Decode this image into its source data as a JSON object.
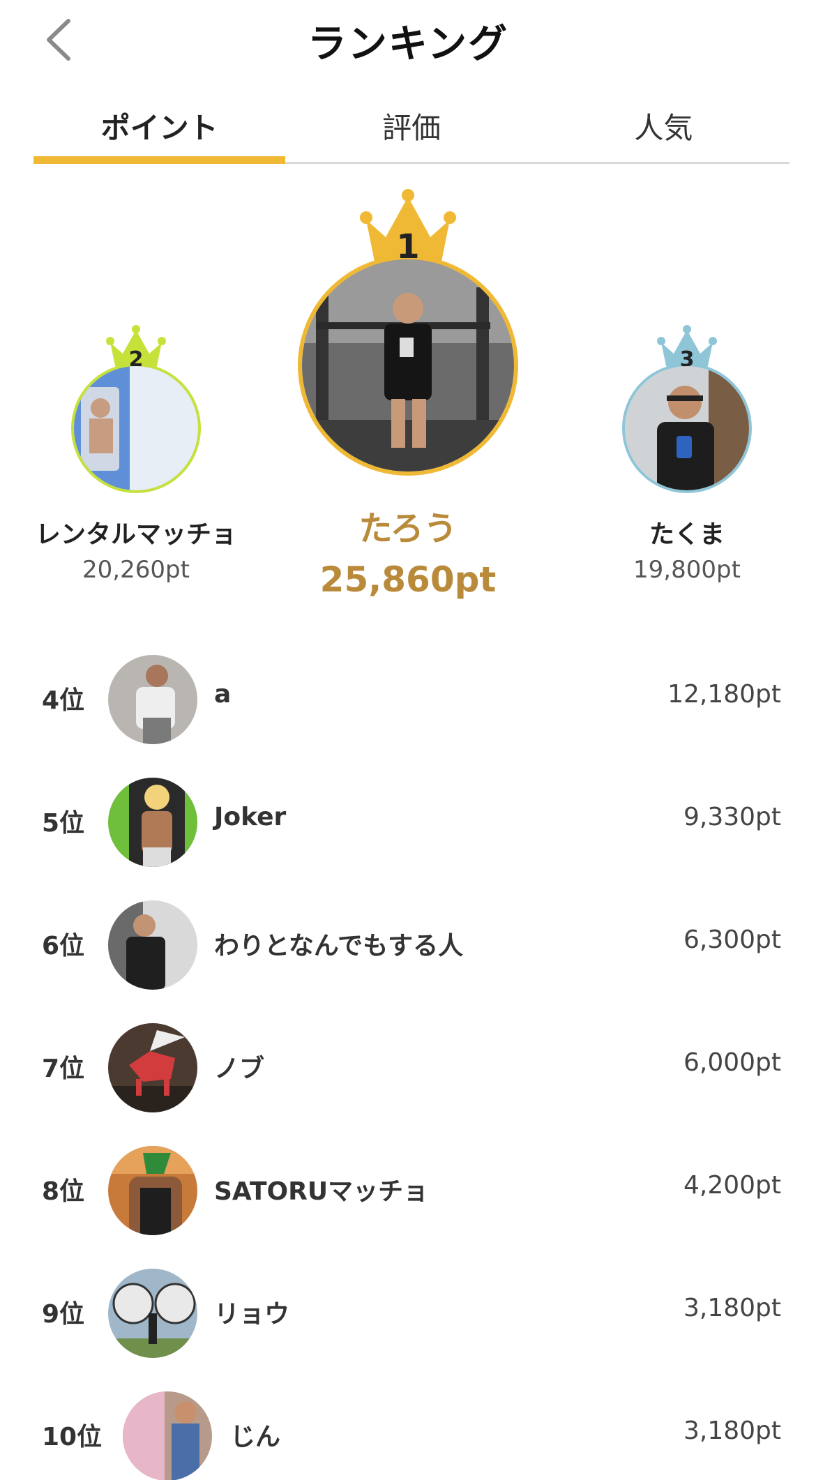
{
  "header": {
    "title": "ランキング"
  },
  "tabs": [
    {
      "label": "ポイント",
      "active": true
    },
    {
      "label": "評価",
      "active": false
    },
    {
      "label": "人気",
      "active": false
    }
  ],
  "podium": {
    "first": {
      "rank": "1",
      "name": "たろう",
      "points": "25,860pt",
      "crown_color": "#f0b935",
      "ring_color": "#f0b935"
    },
    "second": {
      "rank": "2",
      "name": "レンタルマッチョ",
      "points": "20,260pt",
      "crown_color": "#c6e23a",
      "ring_color": "#c6e23a"
    },
    "third": {
      "rank": "3",
      "name": "たくま",
      "points": "19,800pt",
      "crown_color": "#8ec6d8",
      "ring_color": "#8ec6d8"
    }
  },
  "ranking": [
    {
      "rank": "4位",
      "name": "a",
      "points": "12,180pt"
    },
    {
      "rank": "5位",
      "name": "Joker",
      "points": "9,330pt"
    },
    {
      "rank": "6位",
      "name": "わりとなんでもする人",
      "points": "6,300pt"
    },
    {
      "rank": "7位",
      "name": "ノブ",
      "points": "6,000pt"
    },
    {
      "rank": "8位",
      "name": "SATORUマッチョ",
      "points": "4,200pt"
    },
    {
      "rank": "9位",
      "name": "リョウ",
      "points": "3,180pt"
    },
    {
      "rank": "10位",
      "name": "じん",
      "points": "3,180pt"
    }
  ],
  "icons": {
    "back": "chevron-left-icon",
    "crown": "crown-icon"
  },
  "colors": {
    "accent": "#f0b935",
    "first_text": "#b98a3a"
  }
}
